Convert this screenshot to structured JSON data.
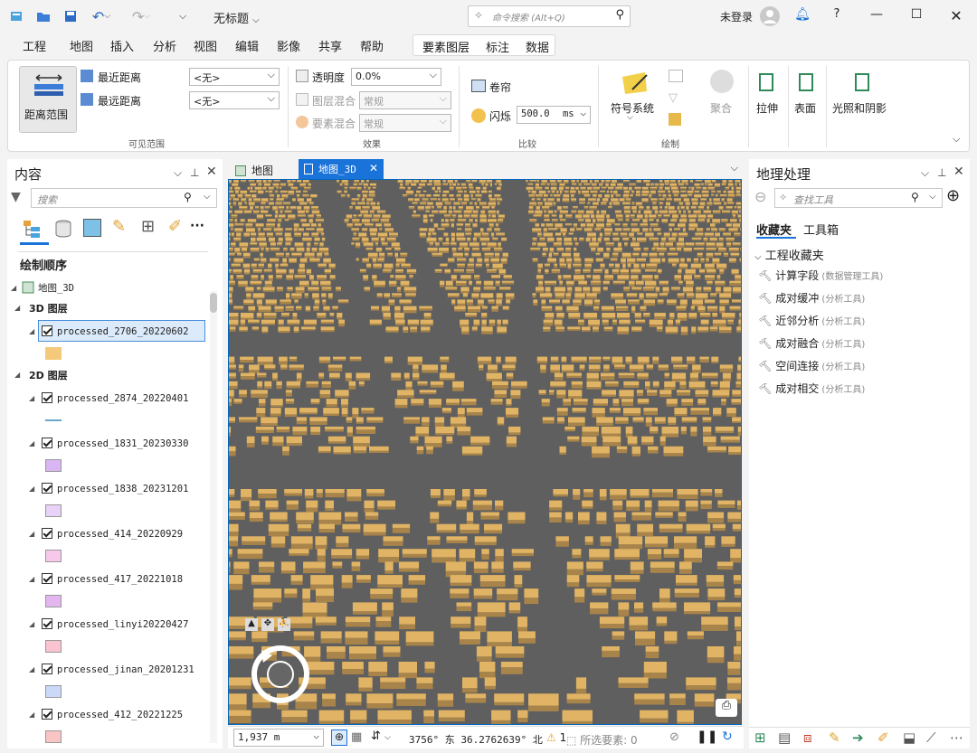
{
  "title_bar": {
    "document_title": "无标题",
    "command_search_placeholder": "命令搜索 (Alt+Q)",
    "login_status": "未登录",
    "help": "?"
  },
  "menu": {
    "tabs": [
      "工程",
      "地图",
      "插入",
      "分析",
      "视图",
      "编辑",
      "影像",
      "共享",
      "帮助"
    ],
    "context_tabs": [
      "要素图层",
      "标注",
      "数据"
    ]
  },
  "ribbon": {
    "visible_range": {
      "button": "距离范围",
      "nearest": "最近距离",
      "farthest": "最远距离",
      "nearest_value": "<无>",
      "farthest_value": "<无>",
      "group": "可见范围"
    },
    "effects": {
      "transparency": "透明度",
      "transparency_value": "0.0%",
      "layer_blend": "图层混合",
      "layer_blend_value": "常规",
      "feature_blend": "要素混合",
      "feature_blend_value": "常规",
      "group": "效果"
    },
    "compare": {
      "swipe": "卷帘",
      "flicker": "闪烁",
      "flicker_value": "500.0",
      "flicker_unit": "ms",
      "group": "比较"
    },
    "drawing": {
      "symbology": "符号系统",
      "aggregation": "聚合",
      "group": "绘制"
    },
    "extrusion": {
      "extrude": "拉伸",
      "surface": "表面",
      "lighting": "光照和阴影"
    }
  },
  "contents": {
    "title": "内容",
    "search_placeholder": "搜索",
    "drawing_order": "绘制顺序",
    "map_name": "地图_3D",
    "group_3d": "3D 图层",
    "group_2d": "2D 图层",
    "layers_3d": [
      {
        "name": "processed_2706_20220602",
        "color": "#f5c97a"
      }
    ],
    "layers_2d": [
      {
        "name": "processed_2874_20220401",
        "color": "#6aa7c6",
        "line": true
      },
      {
        "name": "processed_1831_20230330",
        "color": "#d9b6f3"
      },
      {
        "name": "processed_1838_20231201",
        "color": "#e8d2f7"
      },
      {
        "name": "processed_414_20220929",
        "color": "#f6c9ec"
      },
      {
        "name": "processed_417_20221018",
        "color": "#e4b6ef"
      },
      {
        "name": "processed_linyi20220427",
        "color": "#f9c3d0"
      },
      {
        "name": "processed_jinan_20201231",
        "color": "#c9d9f7"
      },
      {
        "name": "processed_412_20221225",
        "color": "#f8c4c4"
      }
    ]
  },
  "map": {
    "tabs": [
      "地图",
      "地图_3D"
    ],
    "active_tab": "地图_3D",
    "scale": "1,937 m",
    "coordinates": "3756° 东  36.2762639° 北",
    "warnings": "1",
    "selected_label": "所选要素:",
    "selected_count": "0",
    "building_color": "#e0b464",
    "ground_color": "#5f5f5f"
  },
  "geoprocessing": {
    "title": "地理处理",
    "search_placeholder": "查找工具",
    "tabs": [
      "收藏夹",
      "工具箱"
    ],
    "section": "工程收藏夹",
    "tools": [
      {
        "name": "计算字段",
        "toolbox": "(数据管理工具)"
      },
      {
        "name": "成对缓冲",
        "toolbox": "(分析工具)"
      },
      {
        "name": "近邻分析",
        "toolbox": "(分析工具)"
      },
      {
        "name": "成对融合",
        "toolbox": "(分析工具)"
      },
      {
        "name": "空间连接",
        "toolbox": "(分析工具)"
      },
      {
        "name": "成对相交",
        "toolbox": "(分析工具)"
      }
    ]
  }
}
